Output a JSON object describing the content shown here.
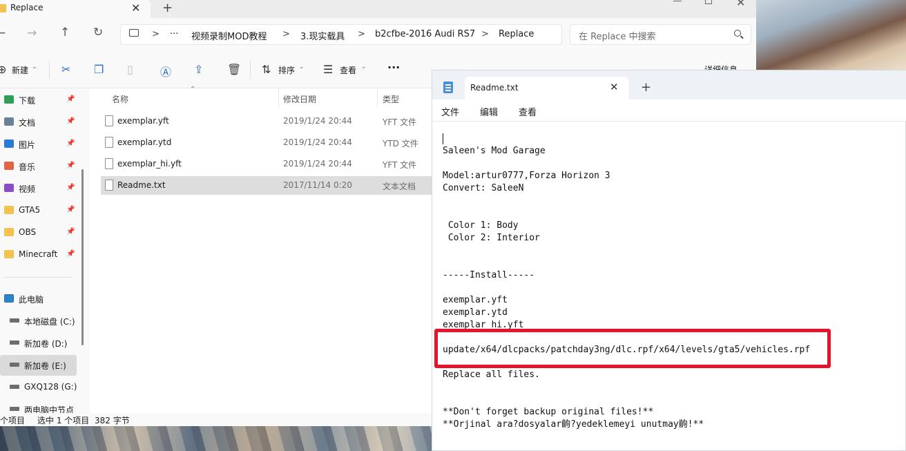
{
  "explorer": {
    "tab_title": "Replace",
    "tab_close": "✕",
    "new_tab": "+",
    "window_close": "✕",
    "nav": {
      "back": "←",
      "forward": "→",
      "up": "↑",
      "refresh": "↻"
    },
    "breadcrumb": {
      "more": "···",
      "separator": ">",
      "items": [
        "视频录制MOD教程",
        "3.现实载具",
        "b2cfbe-2016 Audi RS7",
        "Replace"
      ]
    },
    "search_placeholder": "在 Replace 中搜索",
    "toolbar": {
      "new_label": "新建",
      "sort_label": "排序",
      "view_label": "查看",
      "more": "···",
      "details_label": "详细信息"
    },
    "sidebar": {
      "quick_access": [
        {
          "label": "下载",
          "icon": "download-icon",
          "color": "#2f9e58"
        },
        {
          "label": "文档",
          "icon": "documents-icon",
          "color": "#6d7f96"
        },
        {
          "label": "图片",
          "icon": "pictures-icon",
          "color": "#2b7bd6"
        },
        {
          "label": "音乐",
          "icon": "music-icon",
          "color": "#e0634a"
        },
        {
          "label": "视频",
          "icon": "videos-icon",
          "color": "#8a4cc9"
        },
        {
          "label": "GTA5",
          "icon": "folder-icon",
          "color": "#f2c14e"
        },
        {
          "label": "OBS",
          "icon": "folder-icon",
          "color": "#f2c14e"
        },
        {
          "label": "Minecraft",
          "icon": "folder-icon",
          "color": "#f2c14e"
        }
      ],
      "pin_glyph": "📌",
      "this_pc": "此电脑",
      "drives": [
        {
          "label": "本地磁盘 (C:)"
        },
        {
          "label": "新加卷 (D:)"
        },
        {
          "label": "新加卷 (E:)"
        },
        {
          "label": "GXQ128 (G:)"
        },
        {
          "label": "两电脑中节点"
        }
      ]
    },
    "columns": {
      "name": "名称",
      "date": "修改日期",
      "type": "类型"
    },
    "files": [
      {
        "name": "exemplar.yft",
        "date": "2019/1/24 20:44",
        "type": "YFT 文件"
      },
      {
        "name": "exemplar.ytd",
        "date": "2019/1/24 20:44",
        "type": "YTD 文件"
      },
      {
        "name": "exemplar_hi.yft",
        "date": "2019/1/24 20:44",
        "type": "YFT 文件"
      },
      {
        "name": "Readme.txt",
        "date": "2017/11/14 0:20",
        "type": "文本文档"
      }
    ],
    "status": {
      "item_count": "个项目",
      "selected": "选中 1 个项目",
      "size": "382 字节"
    }
  },
  "notepad": {
    "tab_title": "Readme.txt",
    "tab_close": "✕",
    "new_tab": "+",
    "menu": [
      "文件",
      "编辑",
      "查看"
    ],
    "lines": [
      "Saleen's Mod Garage",
      "",
      "Model:artur0777,Forza Horizon 3",
      "Convert: SaleeN",
      "",
      "",
      " Color 1: Body",
      " Color 2: Interior",
      "",
      "",
      "-----Install-----",
      "",
      "exemplar.yft",
      "exemplar.ytd",
      "exemplar_hi.yft",
      "",
      "update/x64/dlcpacks/patchday3ng/dlc.rpf/x64/levels/gta5/vehicles.rpf",
      "",
      "Replace all files.",
      "",
      "",
      "**Don't forget backup original files!**",
      "**Orjinal ara?dosyalar齣?yedeklemeyi unutmay齣!**"
    ],
    "highlight_color": "#e8132a"
  }
}
